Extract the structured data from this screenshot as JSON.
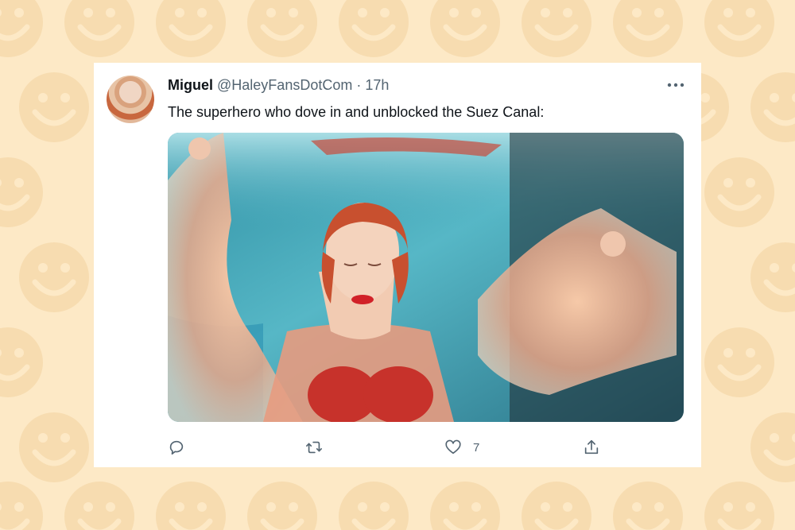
{
  "tweet": {
    "author_name": "Miguel",
    "author_handle": "@HaleyFansDotCom",
    "separator": "·",
    "time": "17h",
    "text": "The superhero who dove in and unblocked the Suez Canal:"
  },
  "actions": {
    "reply_icon": "reply-icon",
    "retweet_icon": "retweet-icon",
    "like_icon": "heart-icon",
    "like_count": "7",
    "share_icon": "share-icon"
  },
  "colors": {
    "background": "#fde9c6",
    "pattern": "#f7dcb0",
    "card": "#ffffff",
    "text": "#0f1419",
    "muted": "#536471"
  }
}
